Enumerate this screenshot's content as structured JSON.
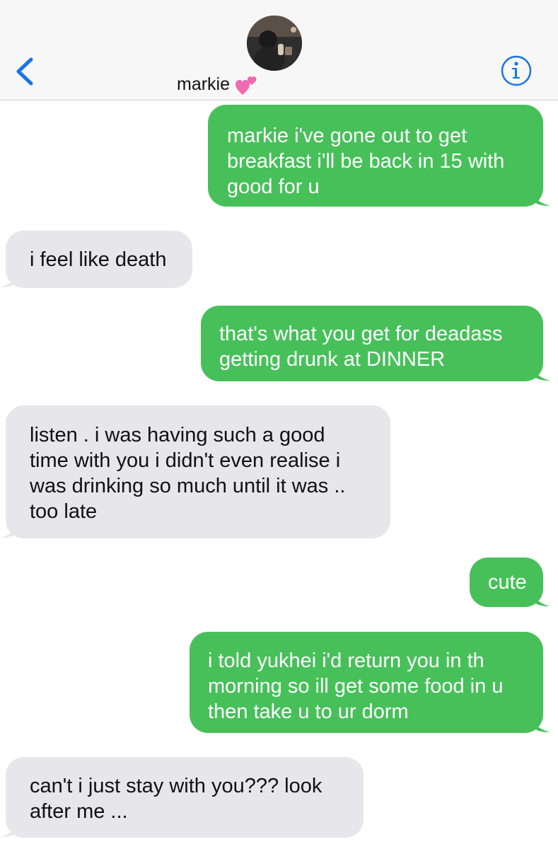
{
  "header": {
    "contact_name": "markie",
    "back_icon": "chevron-left-icon",
    "info_icon": "info-icon",
    "name_emoji": "two-hearts-icon",
    "accent_color": "#1a73e8"
  },
  "colors": {
    "outgoing_bubble": "#47c05a",
    "incoming_bubble": "#e6e6eb"
  },
  "messages": [
    {
      "direction": "out",
      "text": "markie i've gone out to get\nbreakfast i'll be back in 15 with\ngood for u"
    },
    {
      "direction": "in",
      "text": "i feel like death"
    },
    {
      "direction": "out",
      "text": "that's what you get for deadass\ngetting drunk at DINNER"
    },
    {
      "direction": "in",
      "text": "listen . i was having such a good\ntime with you i didn't even realise i\nwas drinking so much until it was ..\ntoo late"
    },
    {
      "direction": "out",
      "text": "cute"
    },
    {
      "direction": "out",
      "text": "i told yukhei i'd return you in th\nmorning so ill get some food in u\nthen take u to ur dorm"
    },
    {
      "direction": "in",
      "text": "can't i just stay with you??? look\nafter me ..."
    }
  ]
}
